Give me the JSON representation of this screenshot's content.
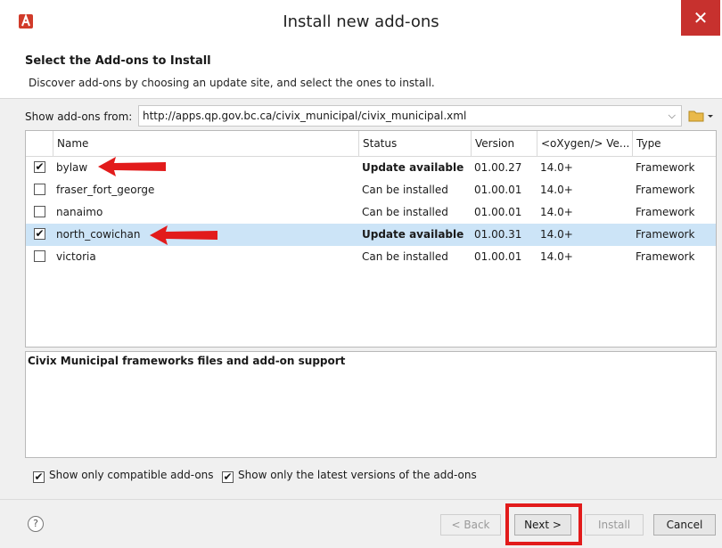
{
  "window": {
    "title": "Install new add-ons",
    "close_label": "✕"
  },
  "header": {
    "title": "Select the Add-ons to Install",
    "description": "Discover add-ons by choosing an update site, and select the ones to install."
  },
  "source": {
    "label": "Show add-ons from:",
    "url": "http://apps.qp.gov.bc.ca/civix_municipal/civix_municipal.xml",
    "arrow": "⌵"
  },
  "table": {
    "columns": [
      "Name",
      "Status",
      "Version",
      "<oXygen/> Ve...",
      "Type"
    ],
    "rows": [
      {
        "checked": "✔",
        "name": "bylaw",
        "status": "Update available",
        "version": "01.00.27",
        "oxygen": "14.0+",
        "type": "Framework"
      },
      {
        "checked": "",
        "name": "fraser_fort_george",
        "status": "Can be installed",
        "version": "01.00.01",
        "oxygen": "14.0+",
        "type": "Framework"
      },
      {
        "checked": "",
        "name": "nanaimo",
        "status": "Can be installed",
        "version": "01.00.01",
        "oxygen": "14.0+",
        "type": "Framework"
      },
      {
        "checked": "✔",
        "name": "north_cowichan",
        "status": "Update available",
        "version": "01.00.31",
        "oxygen": "14.0+",
        "type": "Framework"
      },
      {
        "checked": "",
        "name": "victoria",
        "status": "Can be installed",
        "version": "01.00.01",
        "oxygen": "14.0+",
        "type": "Framework"
      }
    ]
  },
  "description": "Civix Municipal frameworks files and add-on support",
  "options": {
    "compatible_label": "Show only compatible add-ons",
    "latest_label": "Show only the latest versions of the add-ons",
    "check": "✔"
  },
  "footer": {
    "help": "?",
    "back": "< Back",
    "next": "Next >",
    "install": "Install",
    "cancel": "Cancel"
  },
  "colors": {
    "accent_red": "#e21b1b",
    "selected_row": "#cce4f7",
    "close": "#c7312e"
  }
}
